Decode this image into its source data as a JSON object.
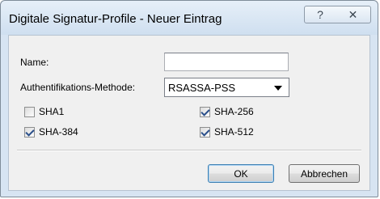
{
  "window": {
    "title": "Digitale Signatur-Profile - Neuer Eintrag"
  },
  "titlebar": {
    "help_icon": "?",
    "close_icon": "✕"
  },
  "form": {
    "name_label": "Name:",
    "name_value": "",
    "auth_label": "Authentifikations-Methode:",
    "auth_value": "RSASSA-PSS",
    "checkboxes": [
      {
        "label": "SHA1",
        "checked": false
      },
      {
        "label": "SHA-256",
        "checked": true
      },
      {
        "label": "SHA-384",
        "checked": true
      },
      {
        "label": "SHA-512",
        "checked": true
      }
    ]
  },
  "buttons": {
    "ok": "OK",
    "cancel": "Abbrechen"
  }
}
